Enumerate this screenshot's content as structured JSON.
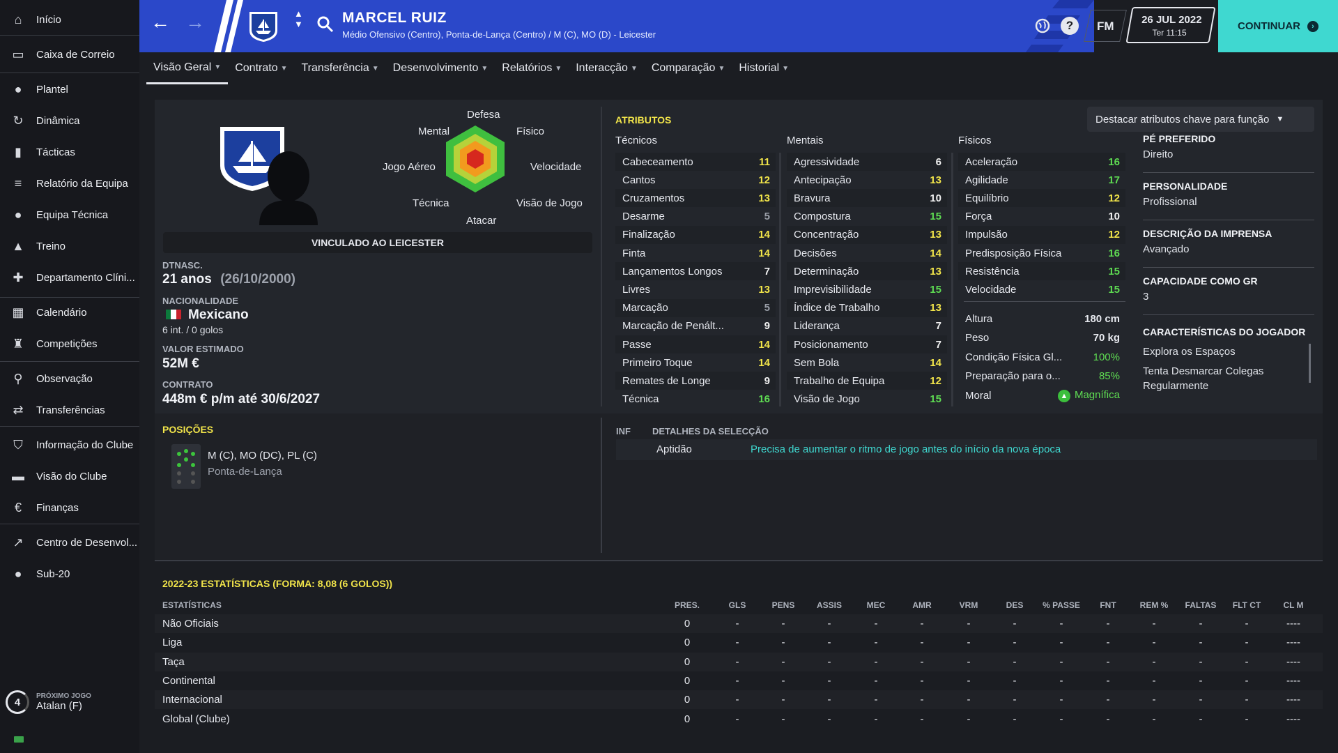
{
  "sidebar": {
    "items": [
      {
        "label": "Início",
        "icon": "home-icon"
      },
      {
        "label": "Caixa de Correio",
        "icon": "inbox-icon"
      },
      {
        "label": "Plantel",
        "icon": "squad-icon"
      },
      {
        "label": "Dinâmica",
        "icon": "dynamics-icon"
      },
      {
        "label": "Tácticas",
        "icon": "tactics-icon"
      },
      {
        "label": "Relatório da Equipa",
        "icon": "report-icon"
      },
      {
        "label": "Equipa Técnica",
        "icon": "staff-icon"
      },
      {
        "label": "Treino",
        "icon": "training-icon"
      },
      {
        "label": "Departamento Clíni...",
        "icon": "medical-icon"
      },
      {
        "label": "Calendário",
        "icon": "calendar-icon"
      },
      {
        "label": "Competições",
        "icon": "trophy-icon"
      },
      {
        "label": "Observação",
        "icon": "scouting-icon"
      },
      {
        "label": "Transferências",
        "icon": "transfers-icon"
      },
      {
        "label": "Informação do Clube",
        "icon": "shield-icon"
      },
      {
        "label": "Visão do Clube",
        "icon": "briefcase-icon"
      },
      {
        "label": "Finanças",
        "icon": "money-icon"
      },
      {
        "label": "Centro de Desenvol...",
        "icon": "development-icon"
      },
      {
        "label": "Sub-20",
        "icon": "u20-icon"
      }
    ],
    "next_match": {
      "caption": "PRÓXIMO JOGO",
      "opponent": "Atalan (F)",
      "count": "4"
    }
  },
  "header": {
    "name": "MARCEL RUIZ",
    "subtitle": "Médio Ofensivo (Centro), Ponta-de-Lança (Centro) / M (C), MO (D) - Leicester",
    "date": "26 JUL 2022",
    "time": "Ter 11:15",
    "fm_label": "FM",
    "continue": "CONTINUAR"
  },
  "tabs": [
    "Visão Geral",
    "Contrato",
    "Transferência",
    "Desenvolvimento",
    "Relatórios",
    "Interacção",
    "Comparação",
    "Historial"
  ],
  "overview": {
    "radar_labels": {
      "top": "Defesa",
      "tl": "Mental",
      "tr": "Físico",
      "l": "Jogo Aéreo",
      "r": "Velocidade",
      "bl": "Técnica",
      "br": "Visão de Jogo",
      "bottom": "Atacar"
    },
    "status": "VINCULADO AO LEICESTER",
    "dob_cap": "DTNASC.",
    "age": "21 anos",
    "dob": "(26/10/2000)",
    "nat_cap": "NACIONALIDADE",
    "nationality": "Mexicano",
    "caps": "6 int. / 0 golos",
    "value_cap": "VALOR ESTIMADO",
    "value": "52M €",
    "contract_cap": "CONTRATO",
    "contract": "448m € p/m até 30/6/2027"
  },
  "attributes": {
    "title": "ATRIBUTOS",
    "highlight": "Destacar atributos chave para função",
    "technical_title": "Técnicos",
    "mental_title": "Mentais",
    "physical_title": "Físicos",
    "technical": [
      {
        "n": "Cabeceamento",
        "v": "11"
      },
      {
        "n": "Cantos",
        "v": "12"
      },
      {
        "n": "Cruzamentos",
        "v": "13"
      },
      {
        "n": "Desarme",
        "v": "5"
      },
      {
        "n": "Finalização",
        "v": "14"
      },
      {
        "n": "Finta",
        "v": "14"
      },
      {
        "n": "Lançamentos Longos",
        "v": "7"
      },
      {
        "n": "Livres",
        "v": "13"
      },
      {
        "n": "Marcação",
        "v": "5"
      },
      {
        "n": "Marcação de Penált...",
        "v": "9"
      },
      {
        "n": "Passe",
        "v": "14"
      },
      {
        "n": "Primeiro Toque",
        "v": "14"
      },
      {
        "n": "Remates de Longe",
        "v": "9"
      },
      {
        "n": "Técnica",
        "v": "16"
      }
    ],
    "mental": [
      {
        "n": "Agressividade",
        "v": "6"
      },
      {
        "n": "Antecipação",
        "v": "13"
      },
      {
        "n": "Bravura",
        "v": "10"
      },
      {
        "n": "Compostura",
        "v": "15"
      },
      {
        "n": "Concentração",
        "v": "13"
      },
      {
        "n": "Decisões",
        "v": "14"
      },
      {
        "n": "Determinação",
        "v": "13"
      },
      {
        "n": "Imprevisibilidade",
        "v": "15"
      },
      {
        "n": "Índice de Trabalho",
        "v": "13"
      },
      {
        "n": "Liderança",
        "v": "7"
      },
      {
        "n": "Posicionamento",
        "v": "7"
      },
      {
        "n": "Sem Bola",
        "v": "14"
      },
      {
        "n": "Trabalho de Equipa",
        "v": "12"
      },
      {
        "n": "Visão de Jogo",
        "v": "15"
      }
    ],
    "physical": [
      {
        "n": "Aceleração",
        "v": "16"
      },
      {
        "n": "Agilidade",
        "v": "17"
      },
      {
        "n": "Equilíbrio",
        "v": "12"
      },
      {
        "n": "Força",
        "v": "10"
      },
      {
        "n": "Impulsão",
        "v": "12"
      },
      {
        "n": "Predisposição Física",
        "v": "16"
      },
      {
        "n": "Resistência",
        "v": "15"
      },
      {
        "n": "Velocidade",
        "v": "15"
      }
    ],
    "body": [
      {
        "n": "Altura",
        "v": "180 cm"
      },
      {
        "n": "Peso",
        "v": "70 kg"
      },
      {
        "n": "Condição Física Gl...",
        "v": "100%"
      },
      {
        "n": "Preparação para o...",
        "v": "85%"
      },
      {
        "n": "Moral",
        "v": "Magnífica"
      }
    ]
  },
  "profile": [
    {
      "cap": "PÉ PREFERIDO",
      "val": "Direito"
    },
    {
      "cap": "PERSONALIDADE",
      "val": "Profissional"
    },
    {
      "cap": "DESCRIÇÃO DA IMPRENSA",
      "val": "Avançado"
    },
    {
      "cap": "CAPACIDADE COMO GR",
      "val": "3"
    }
  ],
  "traits": {
    "cap": "CARACTERÍSTICAS DO JOGADOR",
    "items": [
      "Explora os Espaços",
      "Tenta Desmarcar Colegas Regularmente"
    ]
  },
  "positions": {
    "title": "POSIÇÕES",
    "codes": "M (C), MO (DC), PL (C)",
    "role": "Ponta-de-Lança"
  },
  "selection": {
    "inf": "INF",
    "title": "DETALHES DA SELECÇÃO",
    "label": "Aptidão",
    "text": "Precisa de aumentar o ritmo de jogo antes do início da nova época"
  },
  "stats": {
    "title": "2022-23 ESTATÍSTICAS (FORMA: 8,08 (6 GOLOS))",
    "headers": [
      "ESTATÍSTICAS",
      "PRES.",
      "GLS",
      "PENS",
      "ASSIS",
      "MEC",
      "AMR",
      "VRM",
      "DES",
      "% PASSE",
      "FNT",
      "REM %",
      "FALTAS",
      "FLT CT",
      "CL M"
    ],
    "rows": [
      {
        "name": "Não Oficiais",
        "pres": "0"
      },
      {
        "name": "Liga",
        "pres": "0"
      },
      {
        "name": "Taça",
        "pres": "0"
      },
      {
        "name": "Continental",
        "pres": "0"
      },
      {
        "name": "Internacional",
        "pres": "0"
      },
      {
        "name": "Global (Clube)",
        "pres": "0"
      }
    ],
    "dash": "-",
    "last_dash": "----"
  },
  "colors": {
    "accent": "#2b48c9",
    "continue": "#3fd8d0",
    "attr_high": "#5edb52",
    "attr_mid": "#f2e54a",
    "attr_low": "#9a9fa8"
  }
}
